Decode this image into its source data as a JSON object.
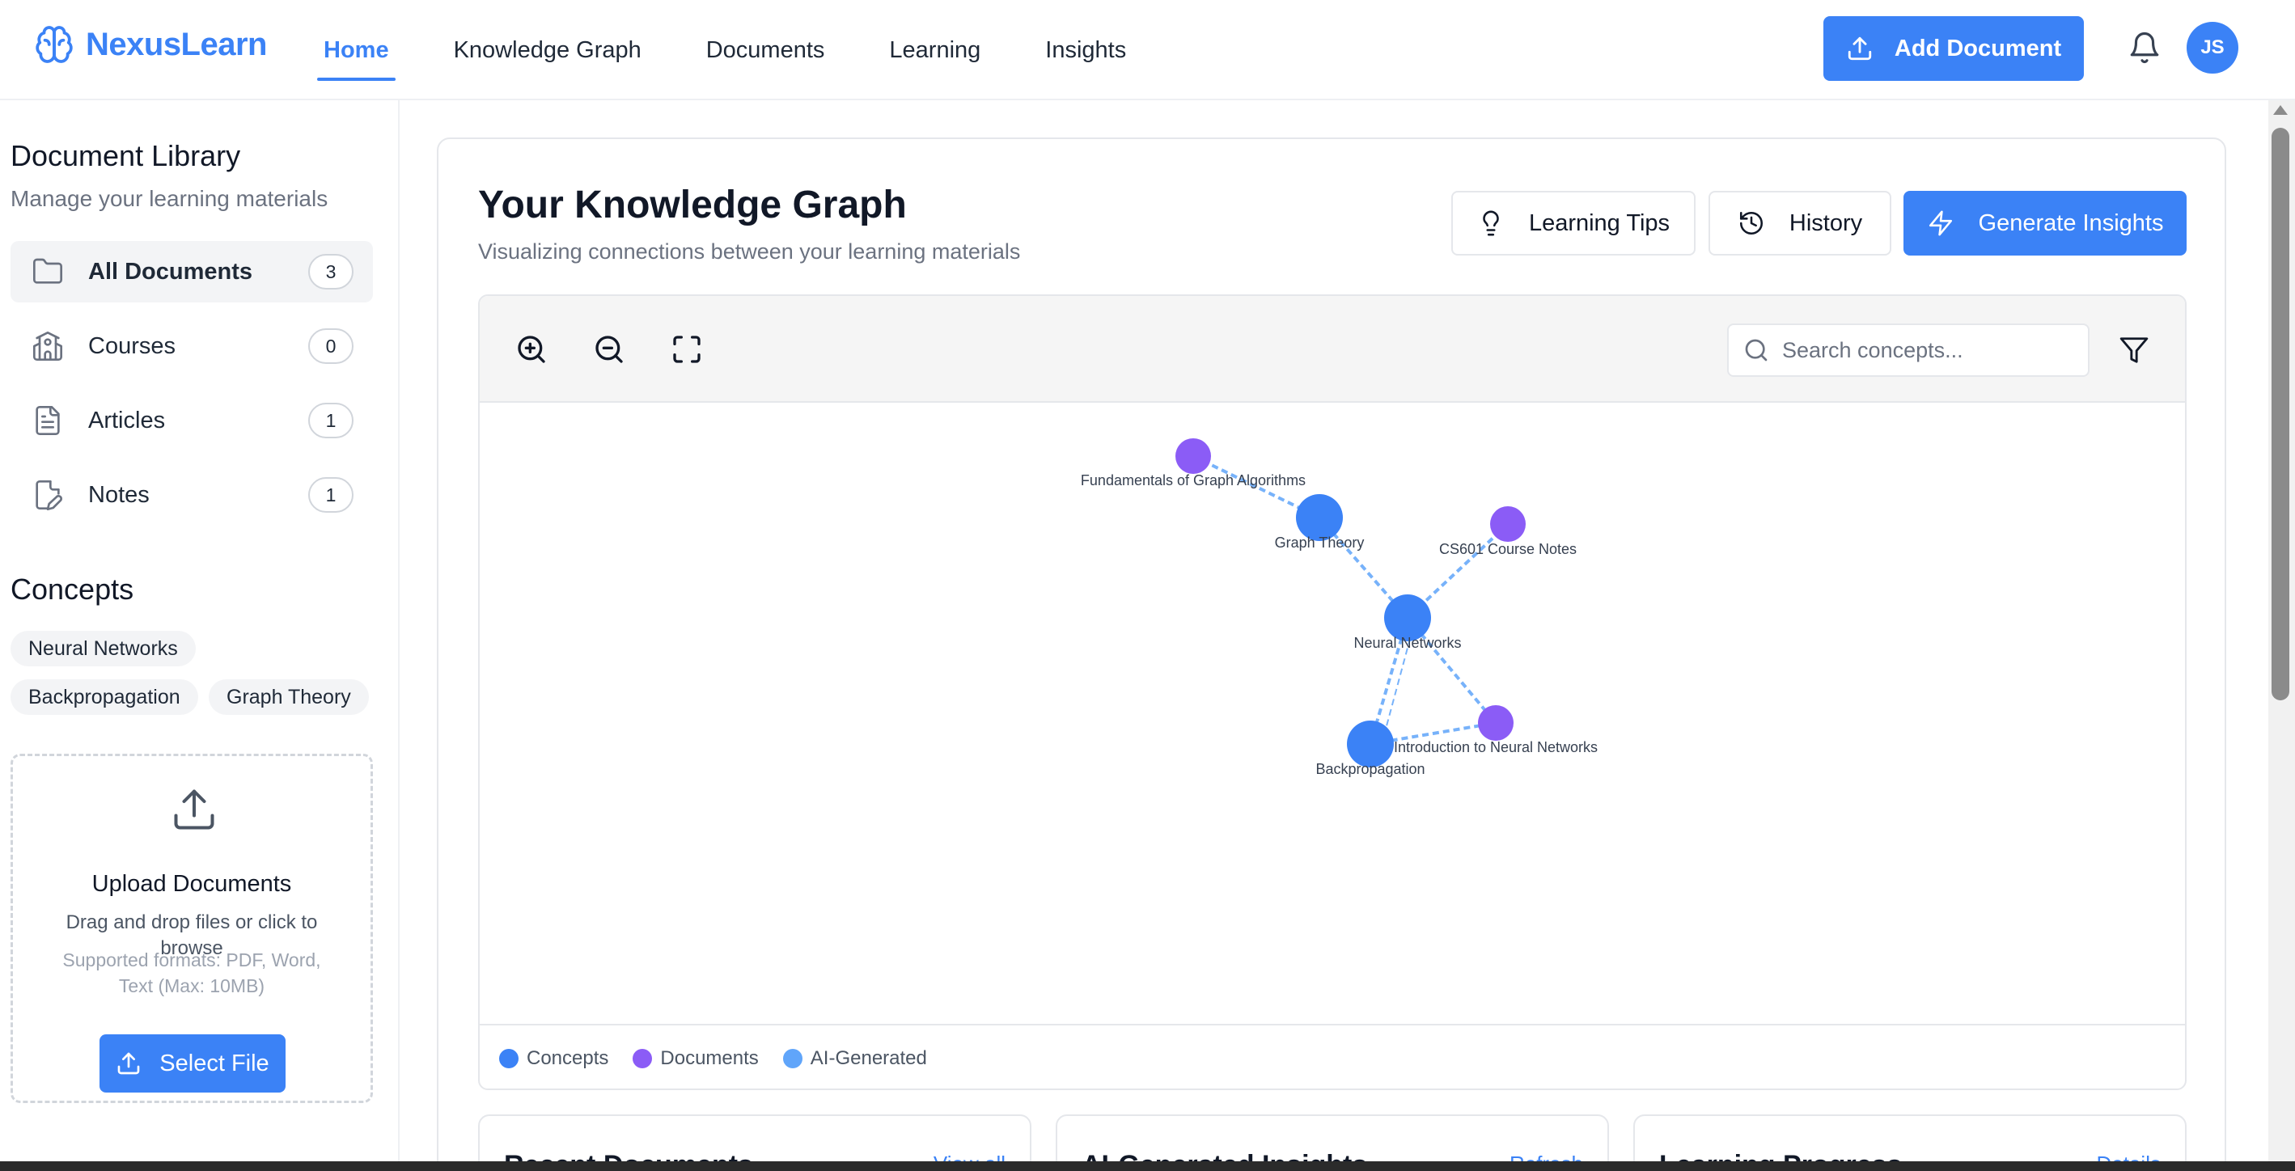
{
  "brand": {
    "name": "NexusLearn"
  },
  "nav": {
    "items": [
      {
        "label": "Home",
        "active": true
      },
      {
        "label": "Knowledge Graph",
        "active": false
      },
      {
        "label": "Documents",
        "active": false
      },
      {
        "label": "Learning",
        "active": false
      },
      {
        "label": "Insights",
        "active": false
      }
    ]
  },
  "header": {
    "add_document_label": "Add Document",
    "avatar_initials": "JS",
    "accent_color": "#3b82f6"
  },
  "sidebar": {
    "title": "Document Library",
    "subtitle": "Manage your learning materials",
    "items": [
      {
        "label": "All Documents",
        "count": "3",
        "icon": "folder-icon"
      },
      {
        "label": "Courses",
        "count": "0",
        "icon": "school-icon"
      },
      {
        "label": "Articles",
        "count": "1",
        "icon": "document-icon"
      },
      {
        "label": "Notes",
        "count": "1",
        "icon": "note-icon"
      }
    ],
    "concepts_title": "Concepts",
    "concepts": [
      "Neural Networks",
      "Backpropagation",
      "Graph Theory"
    ],
    "upload": {
      "title": "Upload Documents",
      "description": "Drag and drop files or click to browse",
      "formats": "Supported formats: PDF, Word, Text (Max: 10MB)",
      "button_label": "Select File"
    }
  },
  "main": {
    "title": "Your Knowledge Graph",
    "subtitle": "Visualizing connections between your learning materials",
    "buttons": {
      "tips": "Learning Tips",
      "history": "History",
      "generate": "Generate Insights"
    },
    "search": {
      "placeholder": "Search concepts...",
      "value": ""
    },
    "graph": {
      "nodes": [
        {
          "id": "fga",
          "label": "Fundamentals of Graph Algorithms",
          "kind": "document"
        },
        {
          "id": "gt",
          "label": "Graph Theory",
          "kind": "concept"
        },
        {
          "id": "cs",
          "label": "CS601 Course Notes",
          "kind": "document"
        },
        {
          "id": "nn",
          "label": "Neural Networks",
          "kind": "concept"
        },
        {
          "id": "bp",
          "label": "Backpropagation",
          "kind": "concept"
        },
        {
          "id": "inn",
          "label": "Introduction to Neural Networks",
          "kind": "document"
        }
      ],
      "edges": [
        [
          "fga",
          "gt"
        ],
        [
          "gt",
          "nn"
        ],
        [
          "cs",
          "nn"
        ],
        [
          "nn",
          "bp"
        ],
        [
          "nn",
          "inn"
        ],
        [
          "bp",
          "inn"
        ]
      ]
    },
    "legend": [
      {
        "label": "Concepts",
        "color": "#3b82f6"
      },
      {
        "label": "Documents",
        "color": "#8b5cf6"
      },
      {
        "label": "AI-Generated",
        "color": "#60a5fa"
      }
    ]
  },
  "bottom_cards": [
    {
      "title": "Recent Documents",
      "link": "View all"
    },
    {
      "title": "AI-Generated Insights",
      "link": "Refresh"
    },
    {
      "title": "Learning Progress",
      "link": "Details"
    }
  ]
}
